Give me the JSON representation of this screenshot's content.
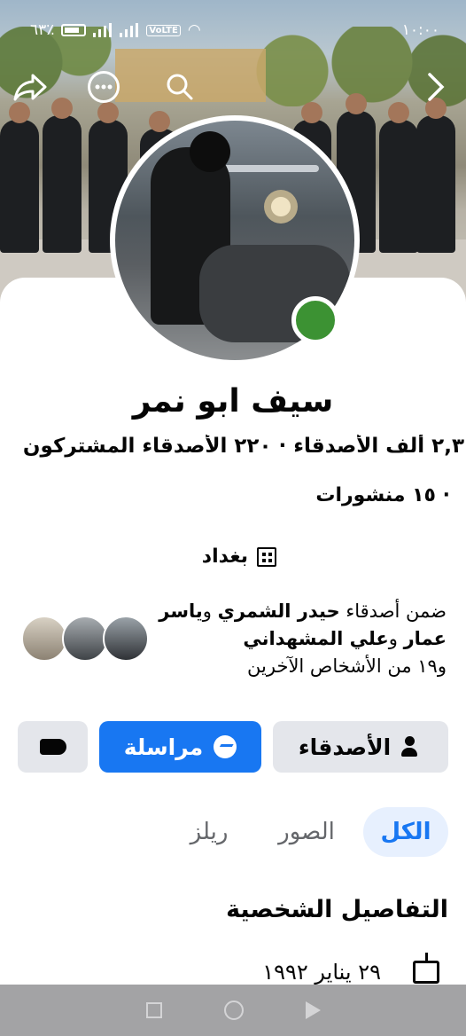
{
  "status_bar": {
    "battery": "٦٣٪",
    "time": "١٠:٠٠",
    "network": "VoLTE"
  },
  "top_actions": {
    "share_icon": "share-icon",
    "more_icon": "more-icon",
    "search_icon": "search-icon",
    "back_icon": "chevron-right-icon"
  },
  "profile": {
    "name": "سيف ابو نمر",
    "stats": "٢,٣ ألف الأصدقاء · ٢٢٠ الأصدقاء المشتركون",
    "posts": "· ١٥ منشورات",
    "city": "بغداد",
    "online": true
  },
  "mutual": {
    "prefix": "ضمن أصدقاء ",
    "friend1": "حيدر الشمري",
    "connector1": " و",
    "friend2": "ياسر عمار",
    "connector2": " و",
    "friend3": "علي المشهداني",
    "others": "و١٩ من الأشخاص الآخرين"
  },
  "buttons": {
    "friends": "الأصدقاء",
    "message": "مراسلة"
  },
  "tabs": {
    "all": "الكل",
    "photos": "الصور",
    "reels": "ريلز"
  },
  "details": {
    "title": "التفاصيل الشخصية",
    "birthday": "٢٩ يناير ١٩٩٢"
  },
  "colors": {
    "accent": "#1877f2",
    "online": "#3c9233",
    "button_gray": "#e4e6eb",
    "tab_active_bg": "#e7f0fe"
  }
}
